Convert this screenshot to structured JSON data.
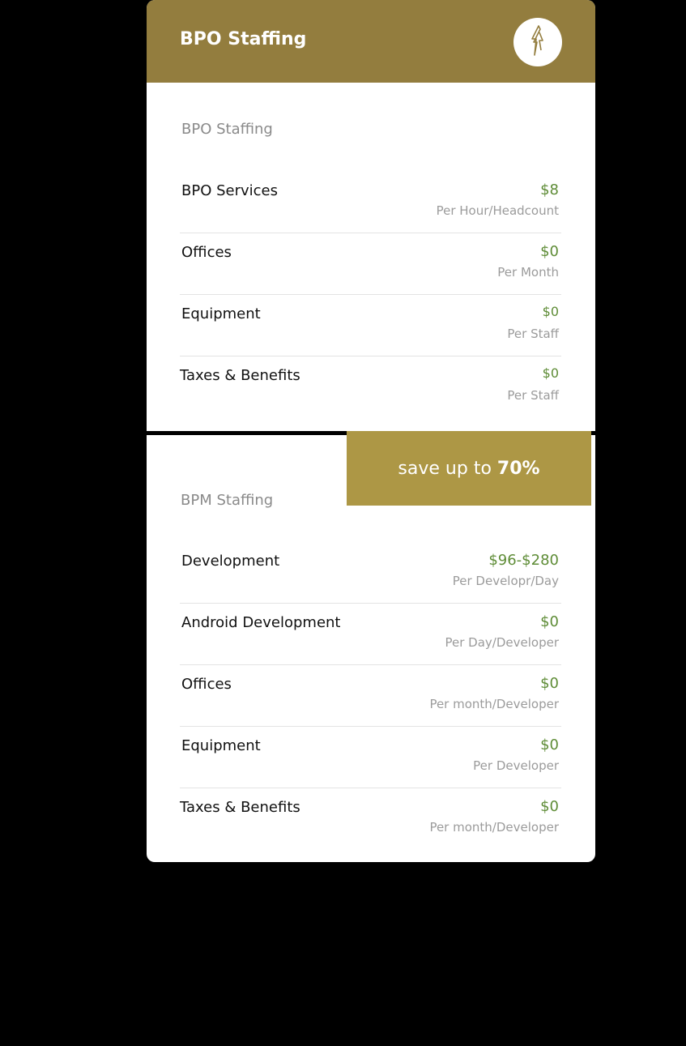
{
  "header": {
    "title": "BPO Staffing",
    "logo_icon": "arrow-bolt-logo-icon",
    "background_color": "#937d3e"
  },
  "bpo": {
    "section_label": "BPO Staffing",
    "rows": [
      {
        "label": "BPO Services",
        "price": "$8",
        "unit": "Per Hour/Headcount"
      },
      {
        "label": "Offices",
        "price": "$0",
        "unit": "Per Month"
      },
      {
        "label": "Equipment",
        "price": "$0",
        "unit": "Per Staff"
      },
      {
        "label": "Taxes & Benefits",
        "price": "$0",
        "unit": "Per Staff"
      }
    ]
  },
  "badge": {
    "text": "save up to",
    "percent": "70%",
    "background_color": "#ad9745"
  },
  "bpm": {
    "section_label": "BPM Staffing",
    "rows": [
      {
        "label": "Development",
        "price": "$96-$280",
        "unit": "Per Developr/Day"
      },
      {
        "label": "Android Development",
        "price": "$0",
        "unit": "Per Day/Developer"
      },
      {
        "label": "Offices",
        "price": "$0",
        "unit": "Per month/Developer"
      },
      {
        "label": "Equipment",
        "price": "$0",
        "unit": "Per Developer"
      },
      {
        "label": "Taxes & Benefits",
        "price": "$0",
        "unit": "Per month/Developer"
      }
    ]
  },
  "colors": {
    "price_green": "#5e8c36",
    "gold": "#937d3e"
  }
}
